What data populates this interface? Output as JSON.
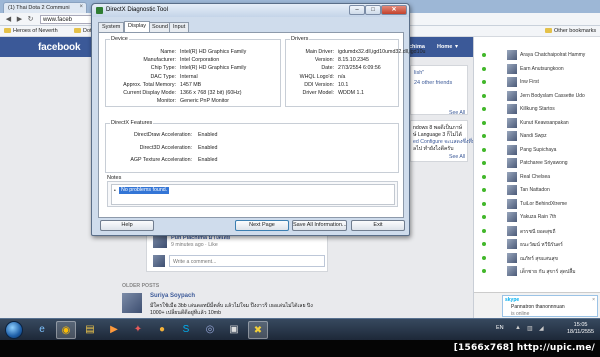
{
  "browser": {
    "tab_title": "(1) Thai Dota 2 Communi",
    "url": "www.faceb",
    "bookmarks": [
      "Heroes of Neverth",
      "Dota"
    ],
    "other_bookmarks": "Other bookmarks"
  },
  "facebook": {
    "logo": "facebook",
    "user_partial": "chima",
    "home_label": "Home",
    "feed": {
      "link_fragment": "lish\"",
      "friends_link": "24 other friends",
      "see_all_1": "See All",
      "side_snippet": [
        "ndows 8 พอดีเป็นภาษ์",
        "ษ์ Language 3 ก็ไม่ได้",
        "ed Configure จะแสดงซึ่งทึ่ม",
        "ลไป ทำยังไงดีครับ"
      ],
      "see_all_2": "See All",
      "commenter": "Pun Plachima ม่าได้เลย",
      "comment_time": "9 minutes ago · Like",
      "comment_placeholder": "Write a comment...",
      "older_posts": "OLDER POSTS",
      "post_author": "Suriya Soypach",
      "post_text_1": "มีใครใช้เมือ 3bb เล่นดอทมีมี่ตลั่บ แล้วไม่ใจม ป๊งงาวรี เธอเล่นไม่ได้เลย ปิง",
      "post_text_2": "1000+ เปลี่ยนดีดีอยู่ทีแล้ว 10mb"
    },
    "chat_friends": [
      "Araya Chatchaipolrat Hammy",
      "Earn Anutsungkoon",
      "Inw First",
      "Jern Bodyslam Cassette Udo",
      "Killkung Startos",
      "Kunut Keawsanpakan",
      "Nandi Swpz",
      "Pang Supichaya",
      "Patcharee Sriyawong",
      "Real Chelsea",
      "Tan Nattadon",
      "TuiLor BehindXtreme",
      "Yakuza Rain 7th",
      "ดรรชนี ยอดสุขถี",
      "ธนะวัฒน์ หวีนิรันดร์",
      "ณภัทร์ สุขแสนสุข",
      "เด็กชาย กัน สุขาร์ สุดปลื้ม"
    ],
    "skype": {
      "brand": "skype",
      "name": "Pannatron thanonnnuan",
      "status": "is online"
    }
  },
  "dxdiag": {
    "title": "DirectX Diagnostic Tool",
    "tabs": [
      "System",
      "Display",
      "Sound",
      "Input"
    ],
    "active_tab": "Display",
    "device": {
      "section_label": "Device",
      "rows": [
        {
          "k": "Name:",
          "v": "Intel(R) HD Graphics Family"
        },
        {
          "k": "Manufacturer:",
          "v": "Intel Corporation"
        },
        {
          "k": "Chip Type:",
          "v": "Intel(R) HD Graphics Family"
        },
        {
          "k": "DAC Type:",
          "v": "Internal"
        },
        {
          "k": "Approx. Total Memory:",
          "v": "1457 MB"
        },
        {
          "k": "Current Display Mode:",
          "v": "1366 x 768 (32 bit) (60Hz)"
        },
        {
          "k": "Monitor:",
          "v": "Generic PnP Monitor"
        }
      ]
    },
    "drivers": {
      "section_label": "Drivers",
      "rows": [
        {
          "k": "Main Driver:",
          "v": "igdumdx32.dll,igd10umd32.dll,igd10u"
        },
        {
          "k": "Version:",
          "v": "8.15.10.2345"
        },
        {
          "k": "Date:",
          "v": "27/3/2554 6:09:56"
        },
        {
          "k": "WHQL Logo'd:",
          "v": "n/a"
        },
        {
          "k": "DDI Version:",
          "v": "10.1"
        },
        {
          "k": "Driver Model:",
          "v": "WDDM 1.1"
        }
      ]
    },
    "features": {
      "section_label": "DirectX Features",
      "rows": [
        {
          "k": "DirectDraw Acceleration:",
          "v": "Enabled"
        },
        {
          "k": "Direct3D Acceleration:",
          "v": "Enabled"
        },
        {
          "k": "AGP Texture Acceleration:",
          "v": "Enabled"
        }
      ]
    },
    "notes": {
      "section_label": "Notes",
      "bullet": "•",
      "line": "No problems found."
    },
    "buttons": {
      "help": "Help",
      "next_page": "Next Page",
      "save_all": "Save All Information...",
      "exit": "Exit"
    }
  },
  "taskbar": {
    "language": "EN",
    "time": "15:05",
    "date": "18/11/2555"
  },
  "watermark": "[1566x768] http://upic.me/"
}
